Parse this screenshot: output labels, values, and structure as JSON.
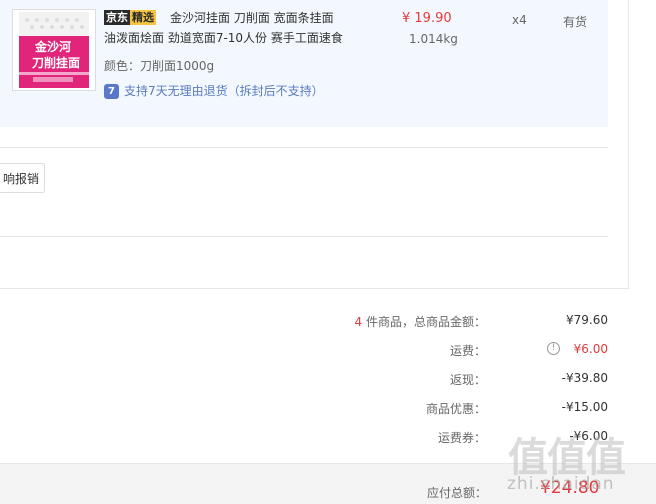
{
  "item": {
    "badge_left": "京东",
    "badge_right": "精选",
    "title_line1": "金沙河挂面 刀削面 宽面条挂面",
    "title_line2": "油泼面烩面 劲道宽面7-10人份 赛手工面速食",
    "spec": "颜色：刀削面1000g",
    "return_icon": "7",
    "return_text": "支持7天无理由退货（拆封后不支持）",
    "price": "¥ 19.90",
    "weight": "1.014kg",
    "qty": "x4",
    "stock": "有货",
    "thumb_text_1": "金沙河",
    "thumb_text_2": "刀削挂面",
    "thumb_icon": "noodle-package-image"
  },
  "invoice": {
    "button_label": "响报销"
  },
  "summary": {
    "count": "4",
    "total_label": " 件商品，总商品金额：",
    "total_value": "¥79.60",
    "freight_label": "运费：",
    "freight_value": "¥6.00",
    "cashback_label": "返现：",
    "cashback_value": "-¥39.80",
    "discount_label": "商品优惠：",
    "discount_value": "-¥15.00",
    "coupon_label": "运费券：",
    "coupon_value": "-¥6.00",
    "payable_label": "应付总额：",
    "payable_value": "¥24.80"
  },
  "watermark": {
    "logo": "值值值",
    "url": "zhi.shaidan"
  },
  "colors": {
    "accent_red": "#e4393c",
    "product_band": "#f3f8fe",
    "return_blue": "#5a7bbf",
    "thumb_pink": "#e0257a"
  }
}
